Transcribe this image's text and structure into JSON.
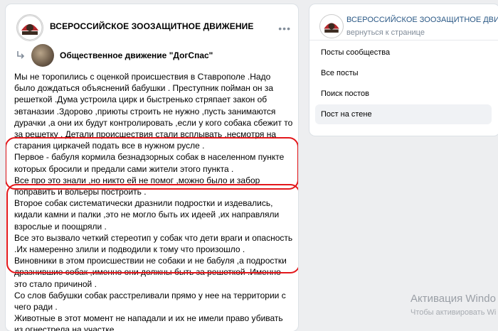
{
  "post": {
    "author": "ВСЕРОССИЙСКОЕ ЗООЗАЩИТНОЕ ДВИЖЕНИЕ",
    "more_icon": "more-horizontal-icon",
    "repost_icon": "repost-arrow-icon",
    "repost_author": "Общественное движение \"ДогСпас\"",
    "paragraphs": [
      "Мы не торопились с оценкой происшествия в Ставрополе .Надо было дождаться объяснений бабушки . Преступник пойман он за решеткой .Дума устроила цирк и быстренько стряпает закон об эвтаназии .Здорово ,приюты строить не нужно ,пусть занимаются дурачки ,а они их будут контролировать ,если у кого собака сбежит то за решетку . Детали происшествия стали всплывать ,несмотря на старания циркачей подать все в нужном русле .",
      "Первое - бабуля кормила безнадзорных собак в населенном пункте которых бросили и предали сами жители этого пункта .\nВсе про это знали ,но никто ей не помог ,можно было и забор поправить и вольеры построить .",
      "Второе собак систематически дразнили подростки и издевались, кидали камни и палки ,это не могло быть их идеей ,их направляли взрослые и поощряли .\nВсе это вызвало четкий стереотип у собак что дети враги и опасность .Их намеренно злили и подводили к тому что произошло .\nВиновники в этом происшествии не собаки и не бабуля ,а подростки дразнившие собак ,именно они должны быть за решеткой .Именно это стало причиной .",
      "Со слов бабушки собак расстреливали прямо у нее на территории с чего ради .\nЖивотные в этот момент не нападали и их не имели право убивать из огнестрела на участке ."
    ]
  },
  "sidebar": {
    "org_name": "ВСЕРОССИЙСКОЕ ЗООЗАЩИТНОЕ ДВИЖ...",
    "back_link": "вернуться к странице",
    "items": [
      {
        "label": "Посты сообщества"
      },
      {
        "label": "Все посты"
      },
      {
        "label": "Поиск постов"
      },
      {
        "label": "Пост на стене"
      }
    ]
  },
  "watermark": {
    "title": "Активация Windo",
    "subtitle": "Чтобы активировать Wi"
  },
  "colors": {
    "highlight": "#e3171b",
    "link": "#2a5885",
    "background": "#edeef0"
  }
}
